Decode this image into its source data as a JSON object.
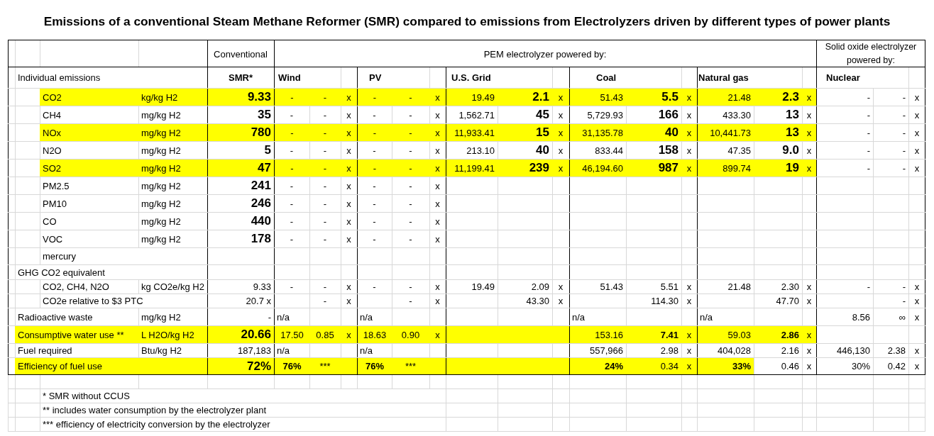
{
  "title": "Emissions of a conventional Steam Methane Reformer (SMR) compared to emissions from Electrolyzers driven by different types of power plants",
  "header": {
    "conventional": "Conventional",
    "pem": "PEM electrolyzer powered by:",
    "solid_oxide": "Solid oxide electrolyzer powered by:"
  },
  "columns": {
    "section": "Individual emissions",
    "smr": "SMR*",
    "wind": "Wind",
    "pv": "PV",
    "grid": "U.S. Grid",
    "coal": "Coal",
    "gas": "Natural gas",
    "nuclear": "Nuclear"
  },
  "rows": [
    {
      "kind": "emission",
      "highlight": true,
      "label": "CO2",
      "unit": "kg/kg H2",
      "smr": "9.33",
      "wind": {
        "column_1": "-",
        "column_2": "-",
        "column_3": "x"
      },
      "pv": {
        "column_1": "-",
        "column_2": "-",
        "column_3": "x"
      },
      "grid": {
        "column_1": "19.49",
        "column_2": "2.1",
        "column_3": "x"
      },
      "coal": {
        "column_1": "51.43",
        "column_2": "5.5",
        "column_3": "x"
      },
      "gas": {
        "column_1": "21.48",
        "column_2": "2.3",
        "column_3": "x"
      },
      "nuclear": {
        "column_1": "-",
        "column_2": "-",
        "column_3": "x"
      }
    },
    {
      "kind": "emission",
      "highlight": false,
      "label": "CH4",
      "unit": "mg/kg H2",
      "smr": "35",
      "wind": {
        "column_1": "-",
        "column_2": "-",
        "column_3": "x"
      },
      "pv": {
        "column_1": "-",
        "column_2": "-",
        "column_3": "x"
      },
      "grid": {
        "column_1": "1,562.71",
        "column_2": "45",
        "column_3": "x"
      },
      "coal": {
        "column_1": "5,729.93",
        "column_2": "166",
        "column_3": "x"
      },
      "gas": {
        "column_1": "433.30",
        "column_2": "13",
        "column_3": "x"
      },
      "nuclear": {
        "column_1": "-",
        "column_2": "-",
        "column_3": "x"
      }
    },
    {
      "kind": "emission",
      "highlight": true,
      "label": "NOx",
      "unit": "mg/kg H2",
      "smr": "780",
      "wind": {
        "column_1": "-",
        "column_2": "-",
        "column_3": "x"
      },
      "pv": {
        "column_1": "-",
        "column_2": "-",
        "column_3": "x"
      },
      "grid": {
        "column_1": "11,933.41",
        "column_2": "15",
        "column_3": "x"
      },
      "coal": {
        "column_1": "31,135.78",
        "column_2": "40",
        "column_3": "x"
      },
      "gas": {
        "column_1": "10,441.73",
        "column_2": "13",
        "column_3": "x"
      },
      "nuclear": {
        "column_1": "-",
        "column_2": "-",
        "column_3": "x"
      }
    },
    {
      "kind": "emission",
      "highlight": false,
      "label": "N2O",
      "unit": "mg/kg H2",
      "smr": "5",
      "wind": {
        "column_1": "-",
        "column_2": "-",
        "column_3": "x"
      },
      "pv": {
        "column_1": "-",
        "column_2": "-",
        "column_3": "x"
      },
      "grid": {
        "column_1": "213.10",
        "column_2": "40",
        "column_3": "x"
      },
      "coal": {
        "column_1": "833.44",
        "column_2": "158",
        "column_3": "x"
      },
      "gas": {
        "column_1": "47.35",
        "column_2": "9.0",
        "column_3": "x"
      },
      "nuclear": {
        "column_1": "-",
        "column_2": "-",
        "column_3": "x"
      }
    },
    {
      "kind": "emission",
      "highlight": true,
      "label": "SO2",
      "unit": "mg/kg H2",
      "smr": "47",
      "wind": {
        "column_1": "-",
        "column_2": "-",
        "column_3": "x"
      },
      "pv": {
        "column_1": "-",
        "column_2": "-",
        "column_3": "x"
      },
      "grid": {
        "column_1": "11,199.41",
        "column_2": "239",
        "column_3": "x"
      },
      "coal": {
        "column_1": "46,194.60",
        "column_2": "987",
        "column_3": "x"
      },
      "gas": {
        "column_1": "899.74",
        "column_2": "19",
        "column_3": "x"
      },
      "nuclear": {
        "column_1": "-",
        "column_2": "-",
        "column_3": "x"
      }
    },
    {
      "kind": "emission",
      "highlight": false,
      "label": "PM2.5",
      "unit": "mg/kg H2",
      "smr": "241",
      "wind": {
        "column_1": "-",
        "column_2": "-",
        "column_3": "x"
      },
      "pv": {
        "column_1": "-",
        "column_2": "-",
        "column_3": "x"
      }
    },
    {
      "kind": "emission",
      "highlight": false,
      "label": "PM10",
      "unit": "mg/kg H2",
      "smr": "246",
      "wind": {
        "column_1": "-",
        "column_2": "-",
        "column_3": "x"
      },
      "pv": {
        "column_1": "-",
        "column_2": "-",
        "column_3": "x"
      }
    },
    {
      "kind": "emission",
      "highlight": false,
      "label": "CO",
      "unit": "mg/kg H2",
      "smr": "440",
      "wind": {
        "column_1": "-",
        "column_2": "-",
        "column_3": "x"
      },
      "pv": {
        "column_1": "-",
        "column_2": "-",
        "column_3": "x"
      }
    },
    {
      "kind": "emission",
      "highlight": false,
      "label": "VOC",
      "unit": "mg/kg H2",
      "smr": "178",
      "wind": {
        "column_1": "-",
        "column_2": "-",
        "column_3": "x"
      },
      "pv": {
        "column_1": "-",
        "column_2": "-",
        "column_3": "x"
      }
    },
    {
      "kind": "item",
      "highlight": false,
      "label": "mercury"
    },
    {
      "kind": "section",
      "highlight": false,
      "label": "GHG CO2 equivalent"
    },
    {
      "kind": "item",
      "highlight": false,
      "label": "CO2, CH4, N2O",
      "unit": "kg CO2e/kg H2",
      "smr": "9.33",
      "wind": {
        "column_1": "-",
        "column_2": "-",
        "column_3": "x"
      },
      "pv": {
        "column_1": "-",
        "column_2": "-",
        "column_3": "x"
      },
      "grid": {
        "column_1": "19.49",
        "column_2": "2.09",
        "column_3": "x"
      },
      "coal": {
        "column_1": "51.43",
        "column_2": "5.51",
        "column_3": "x"
      },
      "gas": {
        "column_1": "21.48",
        "column_2": "2.30",
        "column_3": "x"
      },
      "nuclear": {
        "column_1": "-",
        "column_2": "-",
        "column_3": "x"
      }
    },
    {
      "kind": "item",
      "highlight": false,
      "label": "CO2e relative to $3 PTC",
      "smr": "20.7 x",
      "wind": {
        "column_2": "-",
        "column_3": "x"
      },
      "pv": {
        "column_2": "-",
        "column_3": "x"
      },
      "grid": {
        "column_2": "43.30",
        "column_3": "x"
      },
      "coal": {
        "column_2": "114.30",
        "column_3": "x"
      },
      "gas": {
        "column_2": "47.70",
        "column_3": "x"
      },
      "nuclear": {
        "column_2": "-",
        "column_3": "x"
      }
    },
    {
      "kind": "main",
      "highlight": false,
      "label": "Radioactive waste",
      "unit": "mg/kg H2",
      "smr": "-",
      "wind": {
        "column_1": "n/a"
      },
      "pv": {
        "column_1": "n/a"
      },
      "coal": {
        "column_1": "n/a"
      },
      "gas": {
        "column_1": "n/a"
      },
      "nuclear": {
        "column_1": "8.56",
        "column_2": "∞",
        "column_3": "x"
      }
    },
    {
      "kind": "water",
      "highlight": true,
      "label": "Consumptive water use **",
      "unit": "L H2O/kg H2",
      "smr": "20.66",
      "wind": {
        "column_1": "17.50",
        "column_2": "0.85",
        "column_3": "x"
      },
      "pv": {
        "column_1": "18.63",
        "column_2": "0.90",
        "column_3": "x"
      },
      "coal": {
        "column_1": "153.16",
        "column_2": "7.41",
        "column_3": "x"
      },
      "gas": {
        "column_1": "59.03",
        "column_2": "2.86",
        "column_3": "x"
      }
    },
    {
      "kind": "main",
      "highlight": false,
      "label": "Fuel required",
      "unit": "Btu/kg H2",
      "smr": "187,183",
      "wind": {
        "column_1": "n/a"
      },
      "pv": {
        "column_1": "n/a"
      },
      "coal": {
        "column_1": "557,966",
        "column_2": "2.98",
        "column_3": "x"
      },
      "gas": {
        "column_1": "404,028",
        "column_2": "2.16",
        "column_3": "x"
      },
      "nuclear": {
        "column_1": "446,130",
        "column_2": "2.38",
        "column_3": "x"
      }
    },
    {
      "kind": "efficiency",
      "highlight": true,
      "gas_tail_plain": true,
      "label": "Efficiency of fuel use",
      "smr": "72%",
      "wind": {
        "column_1": "76%",
        "column_2": "***"
      },
      "pv": {
        "column_1": "76%",
        "column_2": "***"
      },
      "coal": {
        "column_1": "24%",
        "column_2": "0.34",
        "column_3": "x"
      },
      "gas": {
        "column_1": "33%",
        "column_2": "0.46",
        "column_3": "x"
      },
      "nuclear": {
        "column_1": "30%",
        "column_2": "0.42",
        "column_3": "x"
      }
    }
  ],
  "footnotes": [
    "* SMR without CCUS",
    "** includes water consumption by the electrolyzer plant",
    "*** efficiency of electricity conversion by the electrolyzer"
  ]
}
